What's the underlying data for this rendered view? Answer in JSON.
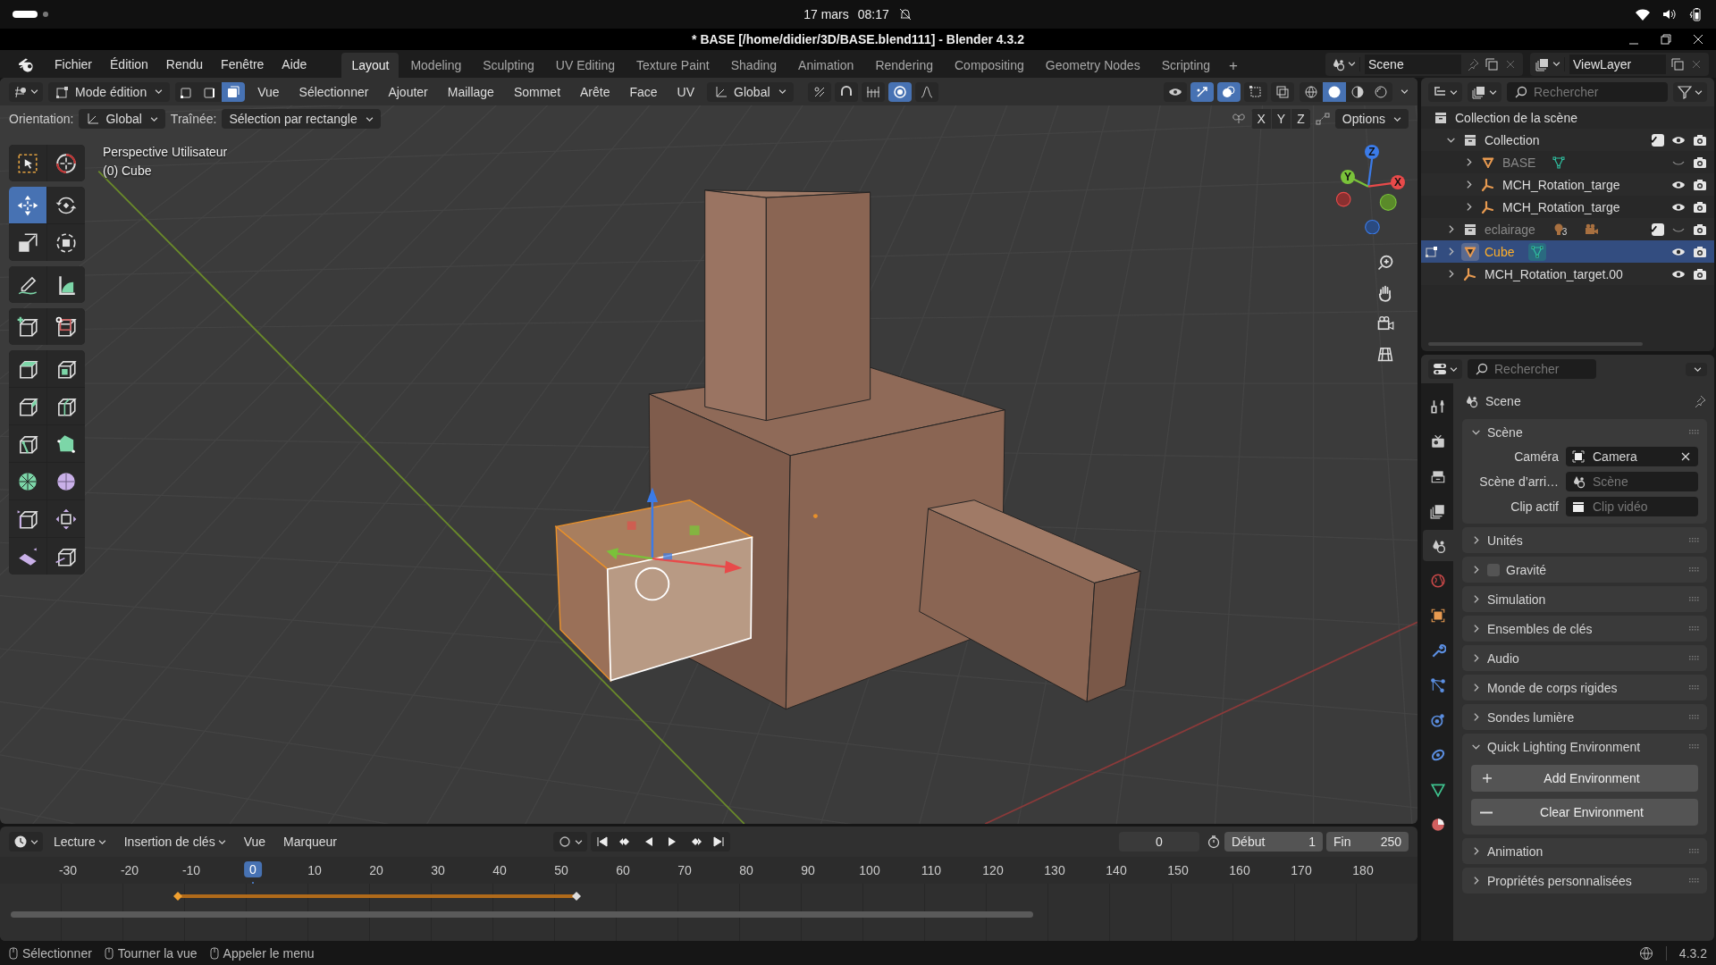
{
  "system_bar": {
    "date": "17 mars",
    "time": "08:17"
  },
  "window": {
    "title": "* BASE [/home/didier/3D/BASE.blend111] - Blender 4.3.2"
  },
  "menus": [
    "Fichier",
    "Édition",
    "Rendu",
    "Fenêtre",
    "Aide"
  ],
  "workspaces": [
    {
      "label": "Layout",
      "selected": true
    },
    {
      "label": "Modeling",
      "selected": false
    },
    {
      "label": "Sculpting",
      "selected": false
    },
    {
      "label": "UV Editing",
      "selected": false
    },
    {
      "label": "Texture Paint",
      "selected": false
    },
    {
      "label": "Shading",
      "selected": false
    },
    {
      "label": "Animation",
      "selected": false
    },
    {
      "label": "Rendering",
      "selected": false
    },
    {
      "label": "Compositing",
      "selected": false
    },
    {
      "label": "Geometry Nodes",
      "selected": false
    },
    {
      "label": "Scripting",
      "selected": false
    }
  ],
  "add_workspace": "+",
  "scene": {
    "value": "Scene"
  },
  "view_layer": {
    "value": "ViewLayer"
  },
  "viewport_header": {
    "mode": "Mode édition",
    "select_modes": [
      {
        "kind": "vertex",
        "selected": false
      },
      {
        "kind": "edge",
        "selected": false
      },
      {
        "kind": "face",
        "selected": true
      }
    ],
    "menus": [
      "Vue",
      "Sélectionner",
      "Ajouter",
      "Maillage",
      "Sommet",
      "Arête",
      "Face",
      "UV"
    ],
    "orientation": "Global",
    "toggles": [
      {
        "kind": "pivot",
        "on": false
      },
      {
        "kind": "snap",
        "on": false
      },
      {
        "kind": "increment",
        "on": false
      },
      {
        "kind": "proportional",
        "on": true
      },
      {
        "kind": "falloff",
        "on": false
      }
    ],
    "view_toggles": [
      {
        "kind": "visibility",
        "on": false
      },
      {
        "kind": "gizmo",
        "on": true
      },
      {
        "kind": "overlays",
        "on": true
      },
      {
        "kind": "mesh_overlay",
        "on": false
      },
      {
        "kind": "xray",
        "on": false
      }
    ],
    "shading": [
      {
        "kind": "wireframe",
        "selected": false
      },
      {
        "kind": "solid",
        "selected": true
      },
      {
        "kind": "material",
        "selected": false
      },
      {
        "kind": "rendered",
        "selected": false
      }
    ]
  },
  "tool_settings": {
    "orientation_label": "Orientation:",
    "orientation": "Global",
    "drag_label": "Traînée:",
    "drag": "Sélection par rectangle",
    "mirror_axes": [
      "X",
      "Y",
      "Z"
    ],
    "options": "Options"
  },
  "viewport": {
    "view_name": "Perspective Utilisateur",
    "object": "(0) Cube",
    "gizmo_axes": [
      "Z",
      "Y",
      "X"
    ]
  },
  "toolbar": {
    "groups": [
      {
        "tools": [
          {
            "kind": "select_box",
            "selected": false
          },
          {
            "kind": "cursor",
            "selected": false
          }
        ]
      },
      {
        "tools": [
          {
            "kind": "move",
            "selected": true
          },
          {
            "kind": "rotate",
            "selected": false
          },
          {
            "kind": "scale",
            "selected": false
          },
          {
            "kind": "transform",
            "selected": false
          }
        ]
      },
      {
        "tools": [
          {
            "kind": "annotate",
            "selected": false
          },
          {
            "kind": "measure",
            "selected": false
          }
        ]
      },
      {
        "tools": [
          {
            "kind": "add_cube",
            "selected": false
          },
          {
            "kind": "cut_cube",
            "selected": false
          }
        ]
      },
      {
        "tools": [
          {
            "kind": "extrude",
            "selected": false
          },
          {
            "kind": "inset",
            "selected": false
          },
          {
            "kind": "bevel",
            "selected": false
          },
          {
            "kind": "loop_cut",
            "selected": false
          },
          {
            "kind": "knife",
            "selected": false
          },
          {
            "kind": "poly_build",
            "selected": false
          },
          {
            "kind": "spin",
            "selected": false
          },
          {
            "kind": "smooth",
            "selected": false
          },
          {
            "kind": "edge_slide",
            "selected": false
          },
          {
            "kind": "shrink",
            "selected": false
          },
          {
            "kind": "shear",
            "selected": false
          },
          {
            "kind": "rip",
            "selected": false
          }
        ]
      }
    ]
  },
  "outliner": {
    "search": {
      "placeholder": "Rechercher"
    },
    "root": "Collection de la scène",
    "items": [
      {
        "name": "Collection",
        "kind": "collection",
        "expanded": true,
        "checked": true,
        "visible": true,
        "selected": false,
        "edit_mode": false,
        "children": [
          {
            "name": "BASE",
            "kind": "mesh",
            "expanded": false,
            "visible": false,
            "selected": false,
            "edit_mode": false,
            "extras": [
              {
                "kind": "mesh_data"
              }
            ]
          },
          {
            "name": "MCH_Rotation_targe",
            "kind": "armature",
            "expanded": false,
            "visible": true,
            "selected": false,
            "edit_mode": false
          },
          {
            "name": "MCH_Rotation_targe",
            "kind": "armature",
            "expanded": false,
            "visible": true,
            "selected": false,
            "edit_mode": false
          }
        ]
      },
      {
        "name": "eclairage",
        "kind": "collection",
        "expanded": false,
        "checked": true,
        "visible": false,
        "selected": false,
        "edit_mode": false,
        "extras": [
          {
            "kind": "light",
            "count": "3"
          },
          {
            "kind": "camera"
          }
        ]
      },
      {
        "name": "Cube",
        "kind": "mesh",
        "expanded": false,
        "visible": true,
        "selected": true,
        "edit_mode": true,
        "extras": [
          {
            "kind": "mesh_data"
          }
        ]
      },
      {
        "name": "MCH_Rotation_target.00",
        "kind": "armature",
        "expanded": false,
        "visible": true,
        "selected": false,
        "edit_mode": false
      }
    ]
  },
  "properties": {
    "search": {
      "placeholder": "Rechercher"
    },
    "tabs": [
      {
        "kind": "tool",
        "selected": false
      },
      {
        "kind": "render",
        "selected": false
      },
      {
        "kind": "output",
        "selected": false
      },
      {
        "kind": "view_layer",
        "selected": false
      },
      {
        "kind": "scene",
        "selected": true
      },
      {
        "kind": "world",
        "selected": false
      },
      {
        "kind": "object",
        "selected": false
      },
      {
        "kind": "modifiers",
        "selected": false
      },
      {
        "kind": "particles",
        "selected": false
      },
      {
        "kind": "physics",
        "selected": false
      },
      {
        "kind": "constraints",
        "selected": false
      },
      {
        "kind": "data",
        "selected": false
      },
      {
        "kind": "material",
        "selected": false
      }
    ],
    "context": "Scene",
    "panels": [
      {
        "title": "Scène",
        "expanded": true,
        "fields": [
          {
            "kind": "camera",
            "label": "Caméra",
            "value": "Camera"
          },
          {
            "kind": "scene",
            "label": "Scène d’arri…",
            "placeholder": "Scène"
          },
          {
            "kind": "clip",
            "label": "Clip actif",
            "placeholder": "Clip vidéo"
          }
        ]
      },
      {
        "title": "Unités",
        "expanded": false
      },
      {
        "title": "Gravité",
        "expanded": false,
        "checked": false
      },
      {
        "title": "Simulation",
        "expanded": false
      },
      {
        "title": "Ensembles de clés",
        "expanded": false
      },
      {
        "title": "Audio",
        "expanded": false
      },
      {
        "title": "Monde de corps rigides",
        "expanded": false
      },
      {
        "title": "Sondes lumière",
        "expanded": false
      },
      {
        "title": "Quick Lighting Environment",
        "expanded": true,
        "buttons": [
          {
            "kind": "add",
            "label": "Add Environment"
          },
          {
            "kind": "remove",
            "label": "Clear Environment"
          }
        ]
      },
      {
        "title": "Animation",
        "expanded": false
      },
      {
        "title": "Propriétés personnalisées",
        "expanded": false
      }
    ]
  },
  "timeline": {
    "menus": [
      "Lecture",
      "Insertion de clés",
      "Vue",
      "Marqueur"
    ],
    "current_frame": "0",
    "start_label": "Début",
    "start": "1",
    "end_label": "Fin",
    "end": "250",
    "ticks": [
      {
        "label": "-30",
        "selected": false
      },
      {
        "label": "-20",
        "selected": false
      },
      {
        "label": "-10",
        "selected": false
      },
      {
        "label": "0",
        "selected": true
      },
      {
        "label": "10",
        "selected": false
      },
      {
        "label": "20",
        "selected": false
      },
      {
        "label": "30",
        "selected": false
      },
      {
        "label": "40",
        "selected": false
      },
      {
        "label": "50",
        "selected": false
      },
      {
        "label": "60",
        "selected": false
      },
      {
        "label": "70",
        "selected": false
      },
      {
        "label": "80",
        "selected": false
      },
      {
        "label": "90",
        "selected": false
      },
      {
        "label": "100",
        "selected": false
      },
      {
        "label": "110",
        "selected": false
      },
      {
        "label": "120",
        "selected": false
      },
      {
        "label": "130",
        "selected": false
      },
      {
        "label": "140",
        "selected": false
      },
      {
        "label": "150",
        "selected": false
      },
      {
        "label": "160",
        "selected": false
      },
      {
        "label": "170",
        "selected": false
      },
      {
        "label": "180",
        "selected": false
      }
    ]
  },
  "status_bar": {
    "hints": [
      "Sélectionner",
      "Tourner la vue",
      "Appeler le menu"
    ],
    "version": "4.3.2"
  }
}
